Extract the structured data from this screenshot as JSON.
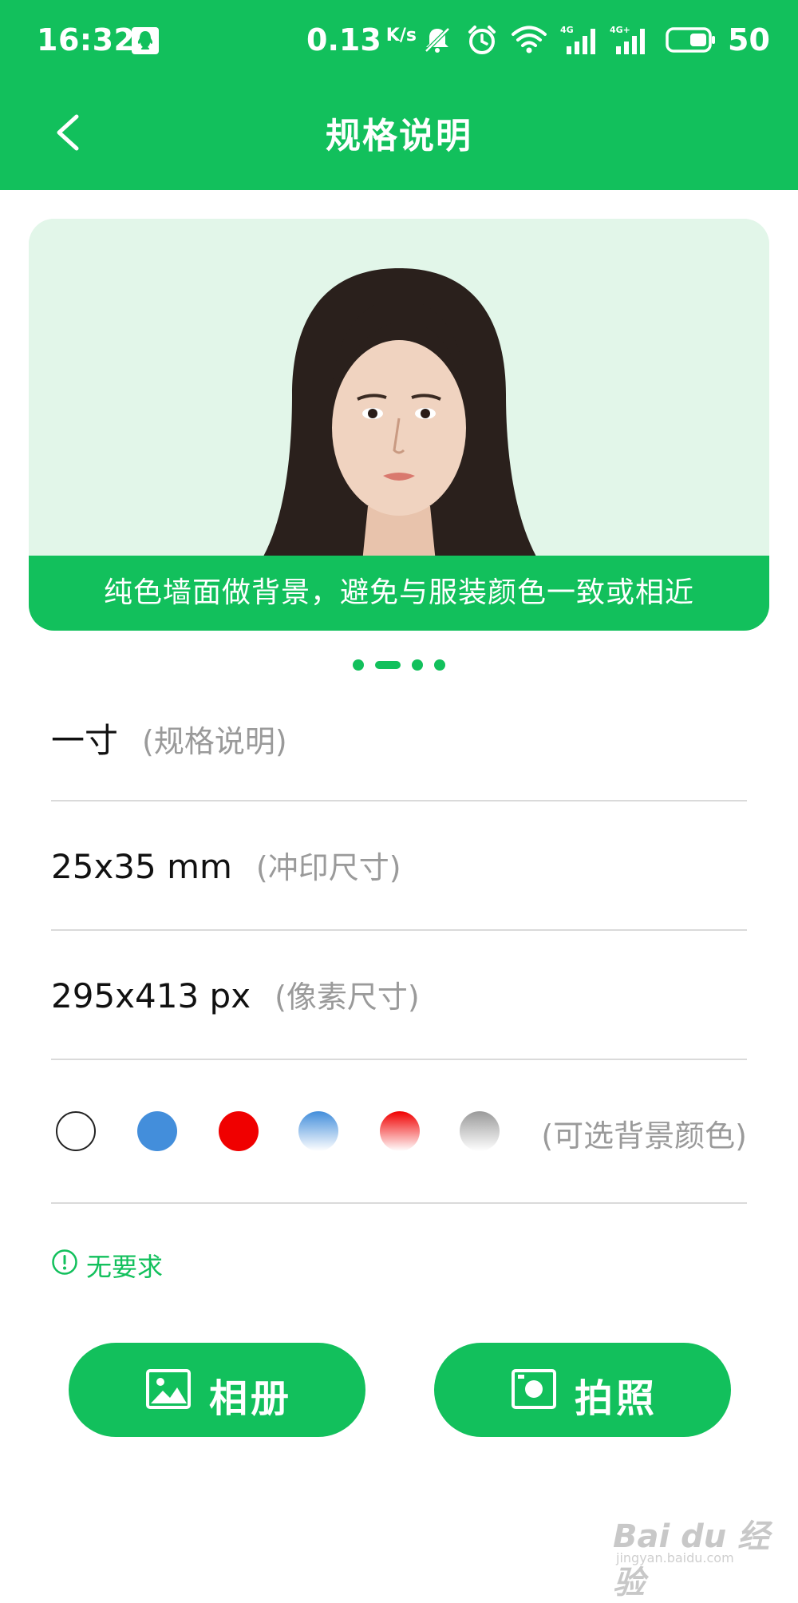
{
  "status_bar": {
    "time": "16:32",
    "net_speed": "0.13",
    "net_speed_unit": "K/s",
    "signal_1_label": "4G",
    "signal_2_label": "4G+",
    "battery": "50"
  },
  "header": {
    "title": "规格说明"
  },
  "banner": {
    "caption": "纯色墙面做背景，避免与服装颜色一致或相近",
    "slide_count": 4,
    "active_slide": 1
  },
  "spec": {
    "size_name": "一寸",
    "size_name_note": "(规格说明)",
    "print_size": "25x35 mm",
    "print_size_note": "(冲印尺寸)",
    "pixel_size": "295x413 px",
    "pixel_size_note": "(像素尺寸)",
    "background_colors_note": "(可选背景颜色)",
    "requirement": "无要求"
  },
  "colors": {
    "accent": "#12c05c",
    "bg_white": "#ffffff",
    "bg_blue": "#438edb",
    "bg_red": "#f00000",
    "bg_blue_gradient": [
      "#438edb",
      "#ffffff"
    ],
    "bg_red_gradient": [
      "#f00000",
      "#ffffff"
    ],
    "bg_gray_gradient": [
      "#9a9a9a",
      "#ffffff"
    ]
  },
  "buttons": {
    "album_label": "相册",
    "camera_label": "拍照"
  },
  "watermark": {
    "text": "Bai du 经验",
    "sub": "jingyan.baidu.com"
  }
}
